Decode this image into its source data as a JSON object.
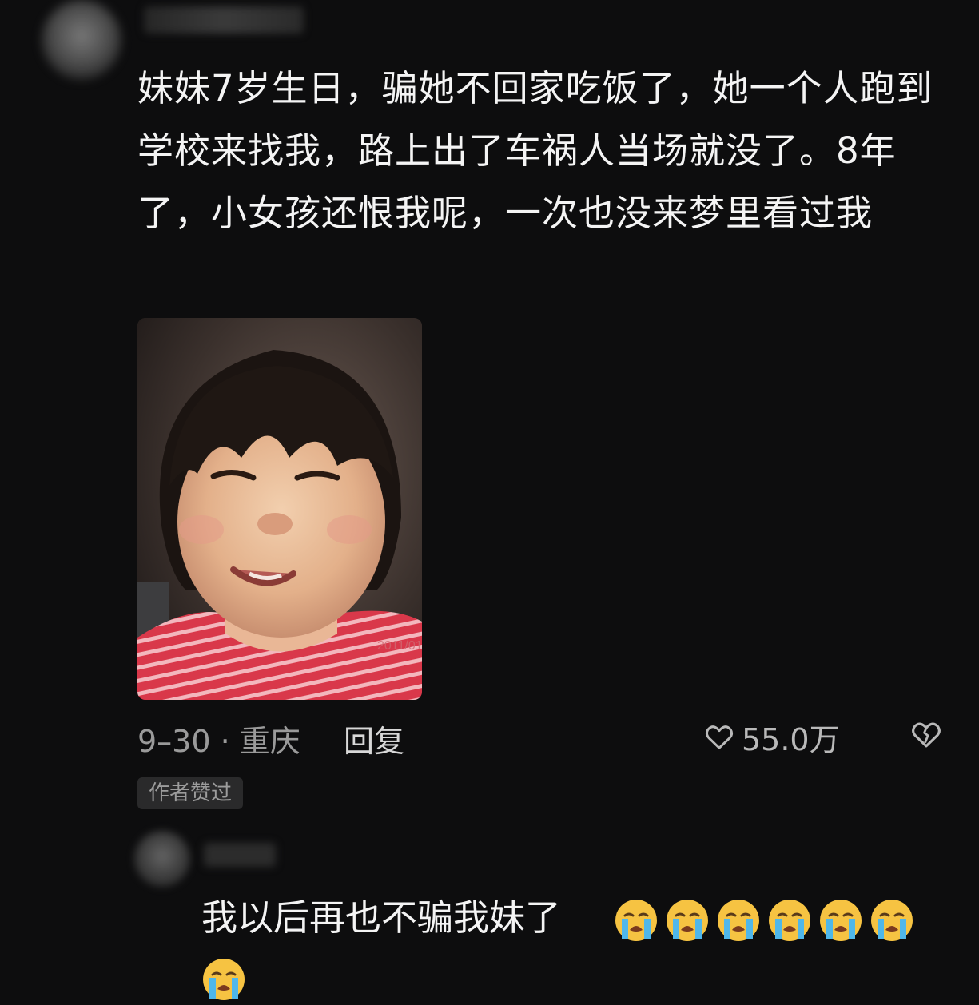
{
  "comment": {
    "text": "妹妹7岁生日，骗她不回家吃饭了，她一个人跑到学校来找我，路上出了车祸人当场就没了。8年了，小女孩还恨我呢，一次也没来梦里看过我",
    "date_location": "9–30 · 重庆",
    "reply_label": "回复",
    "like_count": "55.0万",
    "author_badge": "作者赞过",
    "photo_stamp": "2011/01"
  },
  "reply": {
    "text": "我以后再也不骗我妹了"
  },
  "icons": {
    "like": "heart-outline-icon",
    "dislike": "broken-heart-icon",
    "emoji": "loudly-crying-face-emoji"
  },
  "colors": {
    "background": "#0d0d0e",
    "text_primary": "#f4f4f4",
    "text_secondary": "#9a9a9a",
    "badge_bg": "#2a2a2b",
    "emoji_yellow": "#f6c342",
    "emoji_tears": "#4fb7ea"
  }
}
